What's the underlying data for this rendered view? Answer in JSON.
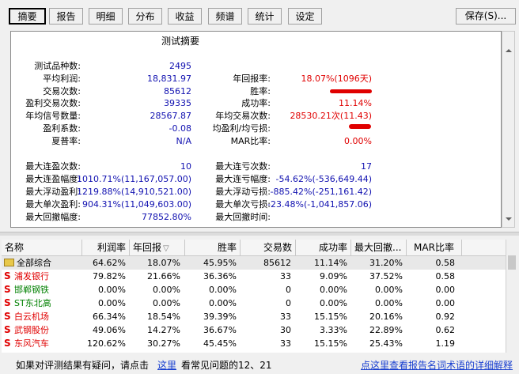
{
  "tabs": [
    {
      "label": "摘要",
      "active": true
    },
    {
      "label": "报告"
    },
    {
      "label": "明细"
    },
    {
      "label": "分布"
    },
    {
      "label": "收益"
    },
    {
      "label": "频谱"
    },
    {
      "label": "统计"
    },
    {
      "label": "设定"
    }
  ],
  "save_label": "保存(S)...",
  "summary": {
    "title": "测试摘要",
    "left": [
      {
        "label": "测试品种数:",
        "value": "2495"
      },
      {
        "label": "平均利润:",
        "value": "18,831.97"
      },
      {
        "label": "交易次数:",
        "value": "85612"
      },
      {
        "label": "盈利交易次数:",
        "value": "39335"
      },
      {
        "label": "年均信号数量:",
        "value": "28567.87"
      },
      {
        "label": "盈利系数:",
        "value": "-0.08"
      },
      {
        "label": "夏普率:",
        "value": "N/A"
      }
    ],
    "right": [
      {
        "label": "年回报率:",
        "value": "18.07%(1096天)"
      },
      {
        "label": "胜率:",
        "value": ""
      },
      {
        "label": "成功率:",
        "value": "11.14%"
      },
      {
        "label": "年均交易次数:",
        "value": "28530.21次(11.43)"
      },
      {
        "label": "均盈利/均亏损:",
        "value": ""
      },
      {
        "label": "MAR比率:",
        "value": "0.00%"
      }
    ],
    "left2": [
      {
        "label": "最大连盈次数:",
        "value": "10"
      },
      {
        "label": "最大连盈幅度:",
        "value": "1010.71%(11,167,057.00)"
      },
      {
        "label": "最大浮动盈利:",
        "value": "1219.88%(14,910,521.00)"
      },
      {
        "label": "最大单次盈利:",
        "value": "904.31%(11,049,603.00)"
      },
      {
        "label": "最大回撤幅度:",
        "value": "77852.80%"
      }
    ],
    "right2": [
      {
        "label": "最大连亏次数:",
        "value": "17"
      },
      {
        "label": "最大连亏幅度:",
        "value": "-54.62%(-536,649.44)"
      },
      {
        "label": "最大浮动亏损:",
        "value": "-885.42%(-251,161.42)"
      },
      {
        "label": "最大单次亏损:",
        "value": "-23.48%(-1,041,857.06)"
      },
      {
        "label": "最大回撤时间:",
        "value": ""
      }
    ]
  },
  "table": {
    "columns": [
      "名称",
      "利润率",
      "年回报",
      "胜率",
      "交易数",
      "成功率",
      "最大回撤...",
      "MAR比率"
    ],
    "rows": [
      {
        "icon": "folder",
        "name": "全部综合",
        "color": "#000000",
        "cells": [
          "64.62%",
          "18.07%",
          "45.95%",
          "85612",
          "11.14%",
          "31.20%",
          "0.58"
        ]
      },
      {
        "icon": "S",
        "name": "浦发银行",
        "color": "#e00000",
        "cells": [
          "79.82%",
          "21.66%",
          "36.36%",
          "33",
          "9.09%",
          "37.52%",
          "0.58"
        ]
      },
      {
        "icon": "S",
        "name": "邯郸钢铁",
        "color": "#008000",
        "cells": [
          "0.00%",
          "0.00%",
          "0.00%",
          "0",
          "0.00%",
          "0.00%",
          "0.00"
        ]
      },
      {
        "icon": "S",
        "name": "ST东北高",
        "color": "#008000",
        "cells": [
          "0.00%",
          "0.00%",
          "0.00%",
          "0",
          "0.00%",
          "0.00%",
          "0.00"
        ]
      },
      {
        "icon": "S",
        "name": "白云机场",
        "color": "#e00000",
        "cells": [
          "66.34%",
          "18.54%",
          "39.39%",
          "33",
          "15.15%",
          "20.16%",
          "0.92"
        ]
      },
      {
        "icon": "S",
        "name": "武钢股份",
        "color": "#e00000",
        "cells": [
          "49.06%",
          "14.27%",
          "36.67%",
          "30",
          "3.33%",
          "22.89%",
          "0.62"
        ]
      },
      {
        "icon": "S",
        "name": "东风汽车",
        "color": "#e00000",
        "cells": [
          "120.62%",
          "30.27%",
          "45.45%",
          "33",
          "15.15%",
          "25.43%",
          "1.19"
        ]
      }
    ]
  },
  "footer": {
    "text1": "如果对评测结果有疑问，请点击",
    "link1": "这里",
    "text2": "看常见问题的12、21",
    "link2": "点这里查看报告名词术语的详细解释"
  }
}
